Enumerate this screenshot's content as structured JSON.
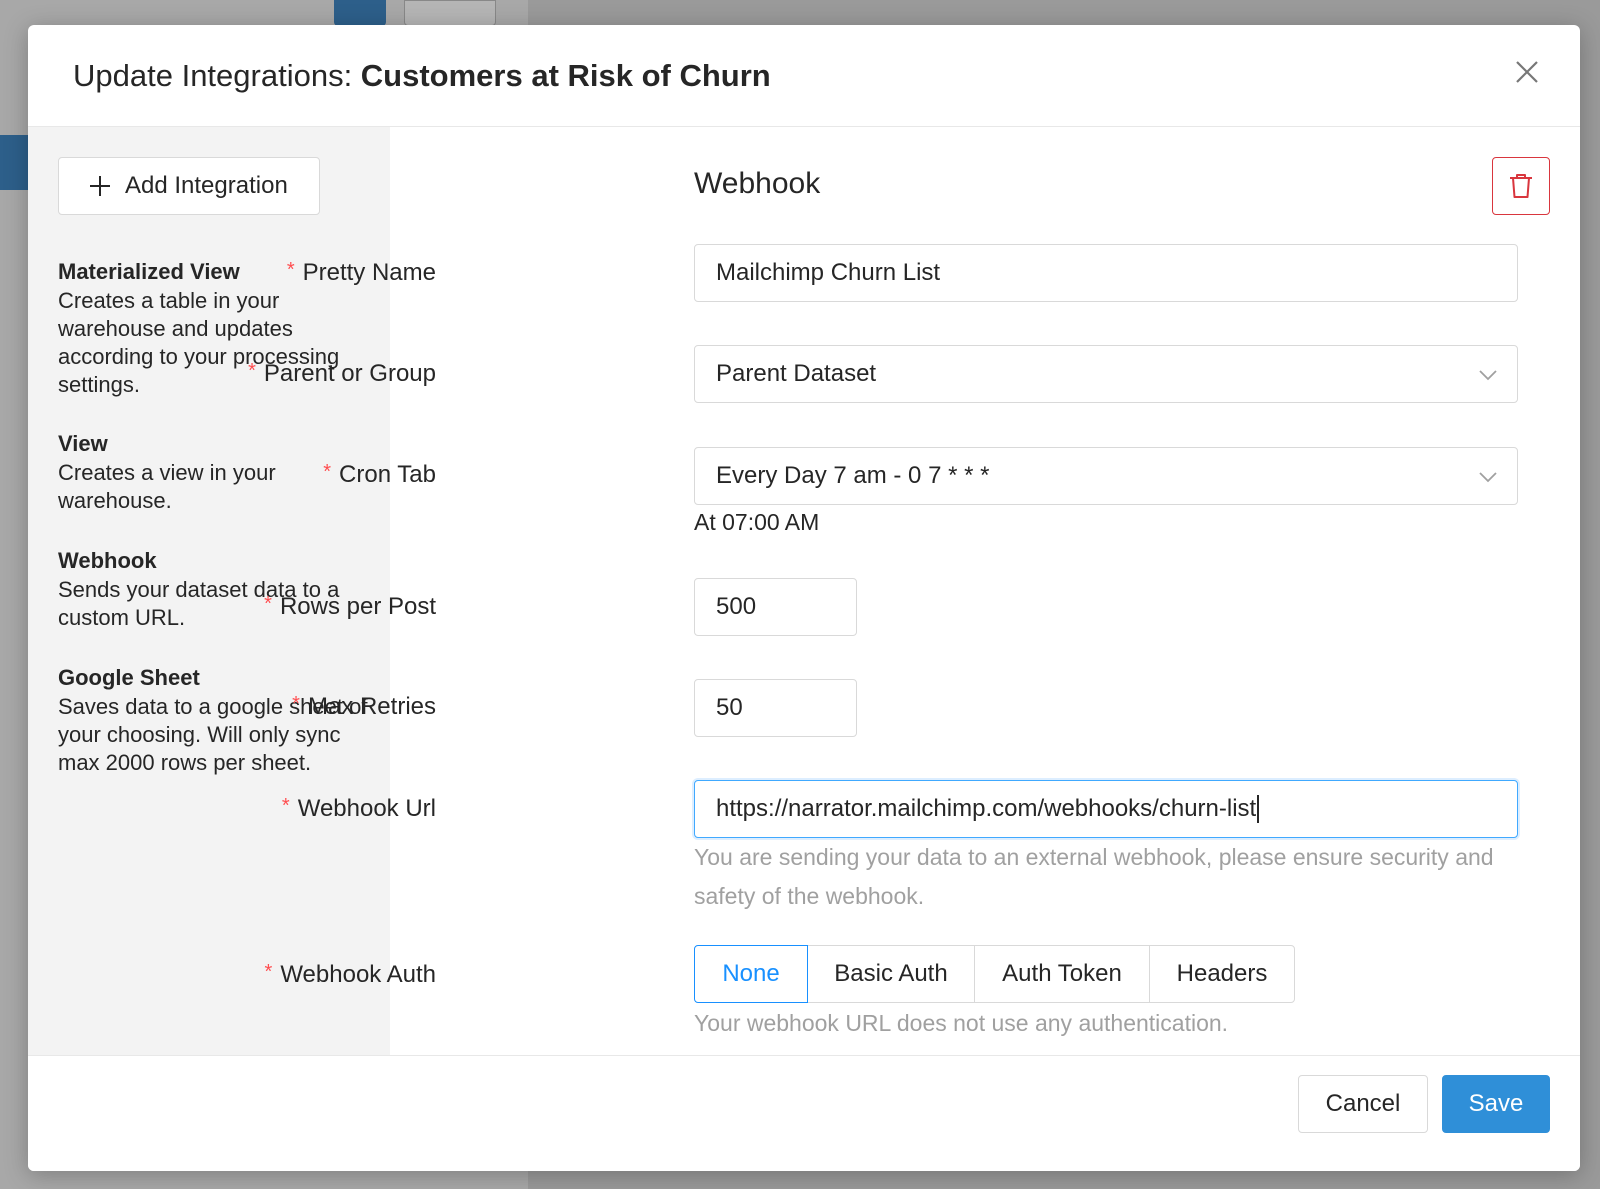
{
  "modal": {
    "title_prefix": "Update Integrations: ",
    "title_name": "Customers at Risk of Churn"
  },
  "sidebar": {
    "add_button": "Add Integration",
    "integrations": [
      {
        "title": "Materialized View",
        "description": "Creates a table in your warehouse and updates according to your processing settings."
      },
      {
        "title": "View",
        "description": "Creates a view in your warehouse."
      },
      {
        "title": "Webhook",
        "description": "Sends your dataset data to a custom URL."
      },
      {
        "title": "Google Sheet",
        "description": "Saves data to a google sheet of your choosing. Will only sync max 2000 rows per sheet."
      }
    ]
  },
  "form": {
    "section_title": "Webhook",
    "required_mark": "*",
    "pretty_name": {
      "label": "Pretty Name",
      "value": "Mailchimp Churn List"
    },
    "parent_group": {
      "label": "Parent or Group",
      "value": "Parent Dataset"
    },
    "cron_tab": {
      "label": "Cron Tab",
      "value": "Every Day 7 am - 0 7 * * *",
      "help": "At 07:00 AM"
    },
    "rows_per_post": {
      "label": "Rows per Post",
      "value": "500"
    },
    "max_retries": {
      "label": "Max Retries",
      "value": "50"
    },
    "webhook_url": {
      "label": "Webhook Url",
      "value": "https://narrator.mailchimp.com/webhooks/churn-list",
      "help": "You are sending your data to an external webhook, please ensure security and safety of the webhook."
    },
    "webhook_auth": {
      "label": "Webhook Auth",
      "options": [
        "None",
        "Basic Auth",
        "Auth Token",
        "Headers"
      ],
      "selected": "None",
      "help": "Your webhook URL does not use any authentication."
    }
  },
  "footer": {
    "cancel": "Cancel",
    "save": "Save"
  },
  "colors": {
    "primary": "#1890ff",
    "save_button": "#2f8fd8",
    "danger": "#d9363e",
    "required": "#ff4d4f"
  }
}
